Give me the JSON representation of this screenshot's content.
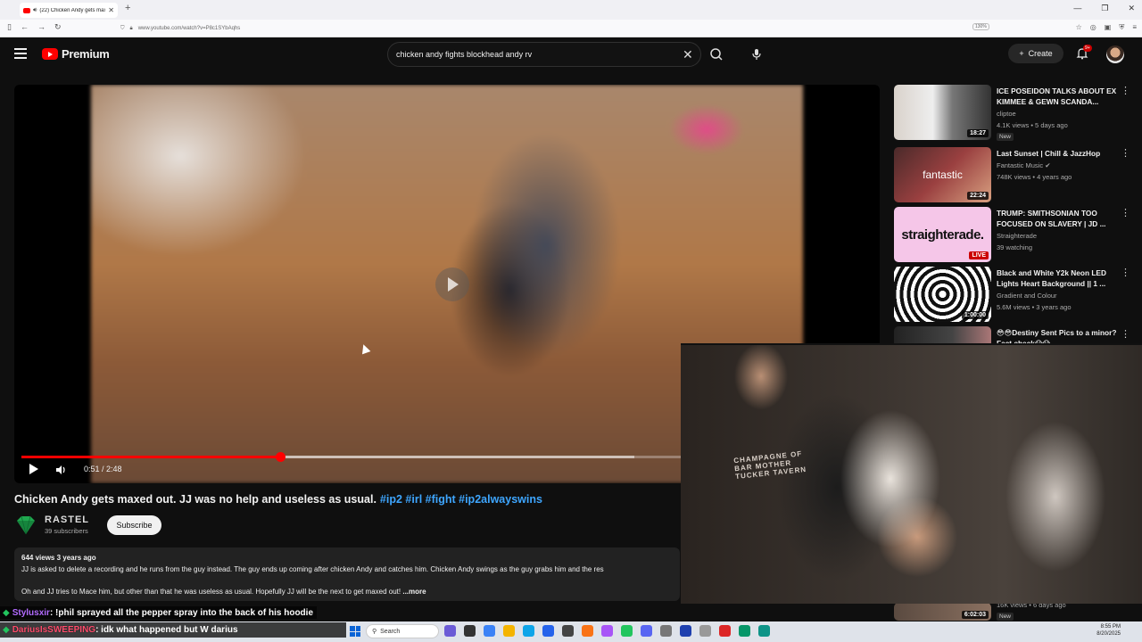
{
  "browser": {
    "tab_title": "(22) Chicken Andy gets max",
    "url": "www.youtube.com/watch?v=P8c1SYbAqhs",
    "zoom": "130%"
  },
  "header": {
    "logo_text": "Premium",
    "search_query": "chicken andy fights blockhead andy rv",
    "create_label": "Create",
    "notification_count": "9+"
  },
  "player": {
    "current_time": "0:51",
    "duration": "2:48",
    "time_display": "0:51 / 2:48",
    "progress_fraction": 0.304,
    "buffered_fraction": 0.72
  },
  "video": {
    "title": "Chicken Andy gets maxed out. JJ was no help and useless as usual.",
    "hashtags": "#ip2 #irl #fight #ip2alwayswins",
    "channel_name": "RASTEL",
    "subscribers": "39 subscribers",
    "subscribe_label": "Subscribe",
    "meta": "644 views  3 years ago",
    "description_line1": "JJ is asked to delete a recording and he runs from the guy instead. The guy ends up coming after chicken Andy and catches him. Chicken Andy swings as the guy grabs him and the res",
    "description_line2": "Oh and JJ tries to Mace him, but other than that he was useless as usual. Hopefully JJ will be the next to get maxed out!",
    "more_label": "...more"
  },
  "recommendations": [
    {
      "title": "ICE POSEIDON TALKS ABOUT EX KIMMEE & GEWN SCANDA...",
      "channel": "cliptoe",
      "meta": "4.1K views • 5 days ago",
      "badge": "New",
      "duration": "18:27",
      "thumb_text": ""
    },
    {
      "title": "Last Sunset | Chill & JazzHop",
      "channel": "Fantastic Music",
      "meta": "748K views • 4 years ago",
      "badge": "",
      "duration": "22:24",
      "thumb_text": "fantastic"
    },
    {
      "title": "TRUMP: SMITHSONIAN TOO FOCUSED ON SLAVERY | JD ...",
      "channel": "Straighterade",
      "meta": "39 watching",
      "badge": "",
      "duration": "LIVE",
      "thumb_text": "straighterade."
    },
    {
      "title": "Black and White Y2k Neon LED Lights Heart Background || 1 ...",
      "channel": "Gradient and Colour",
      "meta": "5.6M views • 3 years ago",
      "badge": "",
      "duration": "1:00:00",
      "thumb_text": ""
    },
    {
      "title": "😳😳Destiny Sent Pics to a minor? Fact check😱😱",
      "channel": "",
      "meta": "",
      "badge": "",
      "duration": "",
      "thumb_text": ""
    },
    {
      "title": "",
      "channel": "",
      "meta": "16K views • 6 days ago",
      "badge": "New",
      "duration": "6:02:03",
      "thumb_text": ""
    }
  ],
  "webcam": {
    "shirt_text": "CHAMPAGNE OF BAR MOTHER TUCKER TAVERN"
  },
  "chat": [
    {
      "user": "Stylusxir",
      "message": ": !phil sprayed all the pepper spray into the back of his hoodie"
    },
    {
      "user": "DariusIsSWEEPING",
      "message": ": idk what happened but W darius"
    }
  ],
  "taskbar": {
    "search_label": "Search",
    "time": "8:55 PM",
    "date": "8/20/2025"
  },
  "colors": {
    "accent": "#ff0000",
    "link": "#3ea6ff",
    "background": "#0f0f0f"
  }
}
